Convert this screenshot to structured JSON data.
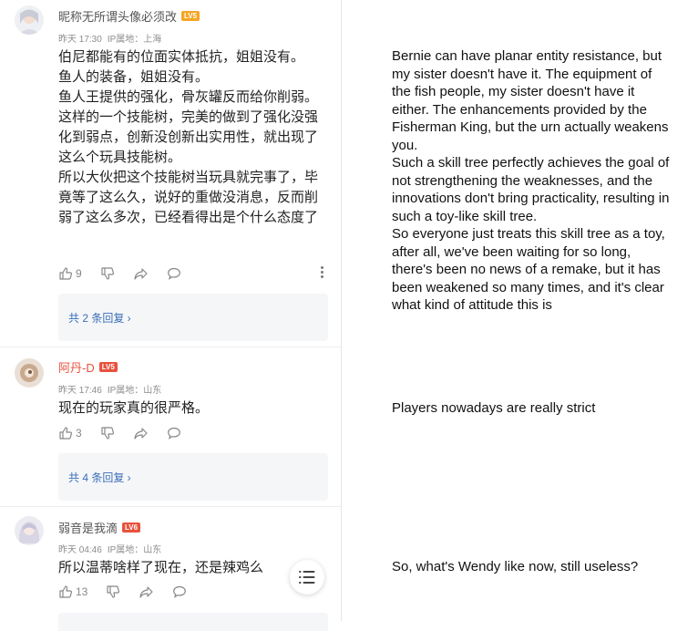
{
  "comments": [
    {
      "username": "昵称无所谓头像必须改",
      "level": "LV5",
      "time": "昨天 17:30",
      "ip": "IP属地：上海",
      "text": "伯尼都能有的位面实体抵抗，姐姐没有。\n鱼人的装备，姐姐没有。\n鱼人王提供的强化，骨灰罐反而给你削弱。\n这样的一个技能树，完美的做到了强化没强化到弱点，创新没创新出实用性，就出现了这么个玩具技能树。\n所以大伙把这个技能树当玩具就完事了，毕竟等了这么久，说好的重做没消息，反而削弱了这么多次，已经看得出是个什么态度了",
      "likes": "9",
      "replies": "共 2 条回复 ›"
    },
    {
      "username": "阿丹-D",
      "level": "LV5",
      "time": "昨天 17:46",
      "ip": "IP属地：山东",
      "text": "现在的玩家真的很严格。",
      "likes": "3",
      "replies": "共 4 条回复 ›"
    },
    {
      "username": "弱音是我滴",
      "level": "LV6",
      "time": "昨天 04:46",
      "ip": "IP属地：山东",
      "text": "所以温蒂啥样了现在，还是辣鸡么",
      "likes": "13"
    }
  ],
  "translations": [
    "Bernie can have planar entity resistance, but my sister doesn't have it. The equipment of the fish people, my sister doesn't have it either. The enhancements provided by the Fisherman King, but the urn actually weakens you.\nSuch a skill tree perfectly achieves the goal of not strengthening the weaknesses, and the innovations don't bring practicality, resulting in such a toy-like skill tree.\nSo everyone just treats this skill tree as a toy, after all, we've been waiting for so long, there's been no news of a remake, but it has been weakened so many times, and it's clear what kind of attitude this is",
    "Players nowadays are really strict",
    "So, what's Wendy like now, still useless?"
  ],
  "icons": {
    "like": "thumb-up-icon",
    "dislike": "thumb-down-icon",
    "share": "share-icon",
    "reply": "comment-icon",
    "more": "more-vertical-icon",
    "menu": "list-menu-icon"
  },
  "colors": {
    "level_badge": "#e8523d",
    "reply_link": "#3b6fb6",
    "username_highlight": "#e8523d"
  }
}
